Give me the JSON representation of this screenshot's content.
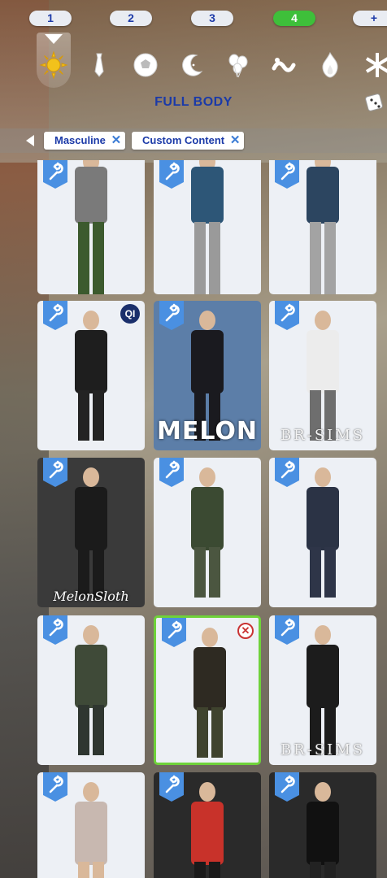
{
  "outfit_tabs": [
    "1",
    "2",
    "3",
    "4",
    "+"
  ],
  "active_outfit_tab": "4",
  "categories": [
    {
      "name": "everyday",
      "icon": "sun-icon"
    },
    {
      "name": "formal",
      "icon": "tie-icon"
    },
    {
      "name": "athletic",
      "icon": "soccer-ball-icon"
    },
    {
      "name": "sleep",
      "icon": "moon-stars-icon"
    },
    {
      "name": "party",
      "icon": "balloons-icon"
    },
    {
      "name": "swimwear",
      "icon": "swim-icon"
    },
    {
      "name": "hot-weather",
      "icon": "flame-icon"
    },
    {
      "name": "cold-weather",
      "icon": "snowflake-icon"
    }
  ],
  "section_title": "FULL BODY",
  "filters": [
    {
      "label": "Masculine"
    },
    {
      "label": "Custom Content"
    }
  ],
  "grid_items": [
    {
      "row": 0,
      "col": 0,
      "outfit": "grey plaid coat, green trousers",
      "badge": "",
      "watermark": "",
      "top_color": "#7a7a7a",
      "bottom_color": "#3c5a2e"
    },
    {
      "row": 0,
      "col": 1,
      "outfit": "blue long coat, grey trousers",
      "badge": "",
      "watermark": "",
      "top_color": "#2d5677",
      "bottom_color": "#9a9a9a"
    },
    {
      "row": 0,
      "col": 2,
      "outfit": "navy jacket, grey trousers",
      "badge": "",
      "watermark": "",
      "top_color": "#2c4560",
      "bottom_color": "#a3a3a3"
    },
    {
      "row": 1,
      "col": 0,
      "outfit": "black long coat suit",
      "badge": "QI",
      "watermark": "",
      "top_color": "#1e1e1e",
      "bottom_color": "#232323"
    },
    {
      "row": 1,
      "col": 1,
      "outfit": "black suit portrait",
      "badge": "",
      "watermark": "MELON",
      "top_color": "#1a1a1f",
      "bottom_color": "#1a1a1f"
    },
    {
      "row": 1,
      "col": 2,
      "outfit": "white shirt, suspenders, plaid trousers",
      "badge": "",
      "watermark": "BR-SIMS",
      "top_color": "#ececec",
      "bottom_color": "#6e6e6e"
    },
    {
      "row": 2,
      "col": 0,
      "outfit": "black suit christmas",
      "badge": "",
      "watermark": "MelonSloth",
      "top_color": "#1b1b1b",
      "bottom_color": "#1b1b1b"
    },
    {
      "row": 2,
      "col": 1,
      "outfit": "tactical gear camo",
      "badge": "",
      "watermark": "",
      "top_color": "#3b4a32",
      "bottom_color": "#4b5640"
    },
    {
      "row": 2,
      "col": 2,
      "outfit": "navy tactical uniform",
      "badge": "",
      "watermark": "",
      "top_color": "#2b3345",
      "bottom_color": "#2e3548"
    },
    {
      "row": 3,
      "col": 0,
      "outfit": "tactical vest camo",
      "badge": "",
      "watermark": "",
      "top_color": "#3f4a38",
      "bottom_color": "#2f3630"
    },
    {
      "row": 3,
      "col": 1,
      "outfit": "masked tactical gear",
      "badge": "x",
      "watermark": "",
      "top_color": "#2e2a22",
      "bottom_color": "#3f432e"
    },
    {
      "row": 3,
      "col": 2,
      "outfit": "black vest, white shirt",
      "badge": "",
      "watermark": "BR-SIMS",
      "top_color": "#1c1c1c",
      "bottom_color": "#1c1c1c"
    },
    {
      "row": 4,
      "col": 0,
      "outfit": "sequin bodysuit",
      "badge": "",
      "watermark": "",
      "top_color": "#c8b8b0",
      "bottom_color": "#d9b89a"
    },
    {
      "row": 4,
      "col": 1,
      "outfit": "red jackets pair",
      "badge": "",
      "watermark": "",
      "top_color": "#c8322a",
      "bottom_color": "#1a1a1a"
    },
    {
      "row": 4,
      "col": 2,
      "outfit": "black suits pair",
      "badge": "",
      "watermark": "",
      "top_color": "#111111",
      "bottom_color": "#222222"
    }
  ],
  "colors": {
    "accent_blue": "#1b3aa8",
    "active_green": "#3ebf3a",
    "selected_border": "#6fd23a",
    "wrench_badge": "#4a90e2"
  }
}
